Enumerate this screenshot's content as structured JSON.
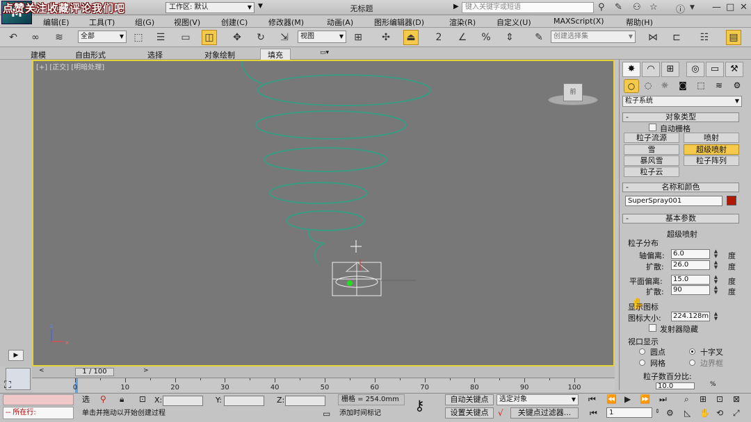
{
  "overlay_text": "点赞关注收藏评论我们吧",
  "title": {
    "workspace_label": "工作区: 默认",
    "window_title": "无标题",
    "search_placeholder": "键入关键字或短语"
  },
  "menu": [
    "编辑(E)",
    "工具(T)",
    "组(G)",
    "视图(V)",
    "创建(C)",
    "修改器(M)",
    "动画(A)",
    "图形编辑器(D)",
    "渲染(R)",
    "自定义(U)",
    "MAXScript(X)",
    "帮助(H)"
  ],
  "toolbar": {
    "filter_select": "全部",
    "view_select": "视图",
    "selection_set_placeholder": "创建选择集"
  },
  "ribbon_tabs": [
    "建模",
    "自由形式",
    "选择",
    "对象绘制",
    "填充"
  ],
  "viewport": {
    "label": "[+] [正交] [明暗处理]",
    "cube_label": "前",
    "axes": {
      "x": "x",
      "y": "y",
      "z": "z"
    }
  },
  "panel": {
    "category": "粒子系统",
    "object_type": {
      "header": "对象类型",
      "auto_grid": "自动栅格",
      "buttons": [
        "粒子流源",
        "喷射",
        "雪",
        "超级喷射",
        "暴风雪",
        "粒子阵列",
        "粒子云"
      ],
      "active": "超级喷射"
    },
    "name_color": {
      "header": "名称和颜色",
      "name": "SuperSpray001",
      "color": "#b01800"
    },
    "basic": {
      "header": "基本参数",
      "subtitle": "超级喷射",
      "dist_group": "粒子分布",
      "axis_offset_label": "轴偏离:",
      "axis_offset": "6.0",
      "axis_spread_label": "扩散:",
      "axis_spread": "26.0",
      "plane_offset_label": "平面偏离:",
      "plane_offset": "15.0",
      "plane_spread_label": "扩散:",
      "plane_spread": "90",
      "unit": "度",
      "icon_group": "显示图标",
      "icon_size_label": "图标大小:",
      "icon_size": "224.128m",
      "emitter_hidden": "发射器隐藏",
      "vp_group": "视口显示",
      "vp_options": [
        "圆点",
        "十字叉",
        "网格",
        "边界框"
      ],
      "vp_selected": "十字叉",
      "percent_label": "粒子数百分比:",
      "percent_value": "10.0",
      "percent_unit": "%"
    }
  },
  "timeline": {
    "slider": "1 / 100",
    "ticks": [
      "0",
      "10",
      "20",
      "30",
      "40",
      "50",
      "60",
      "70",
      "80",
      "90",
      "100"
    ]
  },
  "status": {
    "running_label": "所在行:",
    "select_label": "选",
    "x_label": "X:",
    "y_label": "Y:",
    "z_label": "Z:",
    "grid": "栅格 = 254.0mm",
    "hint": "单击并拖动以开始创建过程",
    "add_time_tag": "添加时间标记",
    "auto_key": "自动关键点",
    "set_key": "设置关键点",
    "key_target": "选定对象",
    "key_filters": "关键点过滤器...",
    "frame": "1"
  }
}
